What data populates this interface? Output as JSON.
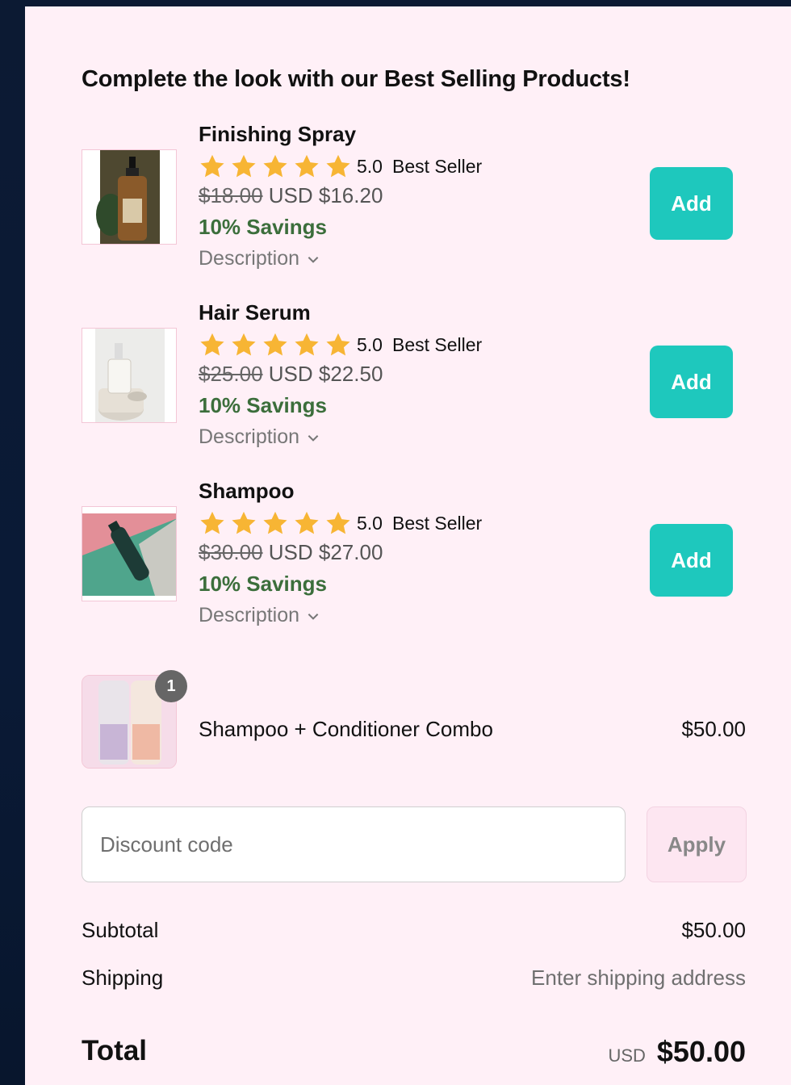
{
  "upsell": {
    "heading": "Complete the look with our Best Selling Products!",
    "add_label": "Add",
    "products": [
      {
        "name": "Finishing Spray",
        "rating": "5.0",
        "badge": "Best Seller",
        "old_price": "$18.00",
        "new_price": "USD $16.20",
        "savings": "10% Savings",
        "description_label": "Description"
      },
      {
        "name": "Hair Serum",
        "rating": "5.0",
        "badge": "Best Seller",
        "old_price": "$25.00",
        "new_price": "USD $22.50",
        "savings": "10% Savings",
        "description_label": "Description"
      },
      {
        "name": "Shampoo",
        "rating": "5.0",
        "badge": "Best Seller",
        "old_price": "$30.00",
        "new_price": "USD $27.00",
        "savings": "10% Savings",
        "description_label": "Description"
      }
    ]
  },
  "cart": {
    "item_name": "Shampoo + Conditioner Combo",
    "item_price": "$50.00",
    "quantity": "1"
  },
  "discount": {
    "placeholder": "Discount code",
    "apply_label": "Apply"
  },
  "summary": {
    "subtotal_label": "Subtotal",
    "subtotal_value": "$50.00",
    "shipping_label": "Shipping",
    "shipping_value": "Enter shipping address",
    "total_label": "Total",
    "total_currency": "USD",
    "total_value": "$50.00"
  },
  "colors": {
    "accent": "#1ec8bd",
    "savings": "#3b6e3b",
    "star": "#f7b534",
    "panel_bg": "#fff0f7"
  }
}
